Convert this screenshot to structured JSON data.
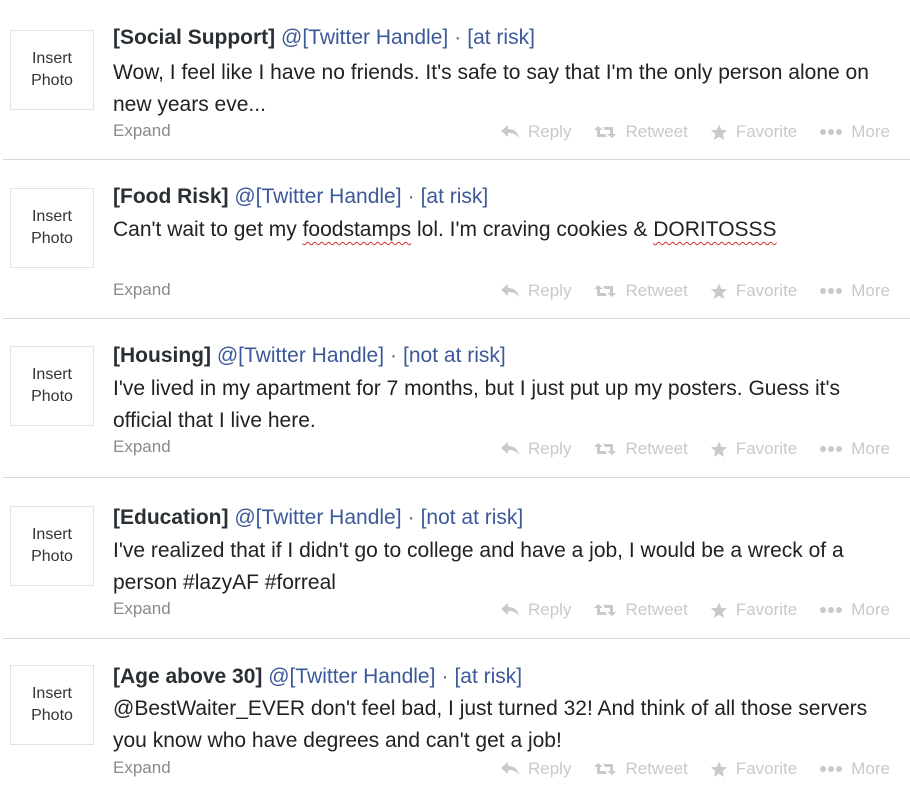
{
  "tweets": [
    {
      "category": "[Social Support]",
      "handle": "@[Twitter Handle]",
      "separator": "·",
      "risk": "[at risk]",
      "text": "Wow, I feel like I have no friends. It's safe to say that I'm the only person alone on new years eve...",
      "photo_line1": "Insert",
      "photo_line2": "Photo",
      "expand": "Expand"
    },
    {
      "category": "[Food Risk]",
      "handle": "@[Twitter Handle]",
      "separator": "·",
      "risk": "[at risk]",
      "text_a": "Can't wait to get my ",
      "text_b": "foodstamps",
      "text_c": " lol. I'm craving cookies & ",
      "text_d": "DORITOSSS",
      "photo_line1": "Insert",
      "photo_line2": "Photo",
      "expand": "Expand"
    },
    {
      "category": "[Housing]",
      "handle": "@[Twitter Handle]",
      "separator": "·",
      "risk": "[not at risk]",
      "text": "I've lived in my apartment for 7 months, but I just put up my posters. Guess it's official that I live here.",
      "photo_line1": "Insert",
      "photo_line2": "Photo",
      "expand": "Expand"
    },
    {
      "category": "[Education]",
      "handle": "@[Twitter Handle]",
      "separator": "·",
      "risk": "[not at risk]",
      "text": "I've realized that if I didn't go to college and have a job, I would be a wreck of a person #lazyAF #forreal",
      "photo_line1": "Insert",
      "photo_line2": "Photo",
      "expand": "Expand"
    },
    {
      "category": "[Age above 30]",
      "handle": "@[Twitter Handle]",
      "separator": "·",
      "risk": "[at risk]",
      "text": "@BestWaiter_EVER don't feel bad, I just turned 32! And think of all those servers you know who have degrees and can't get a job!",
      "photo_line1": "Insert",
      "photo_line2": "Photo",
      "expand": "Expand"
    }
  ],
  "actions": {
    "reply": "Reply",
    "retweet": "Retweet",
    "favorite": "Favorite",
    "more": "More"
  },
  "icons": [
    "reply-icon",
    "retweet-icon",
    "favorite-icon",
    "more-icon"
  ],
  "colors": {
    "link": "#3b5998",
    "muted": "#c9c9c9",
    "expand": "#8a8a8a",
    "spellcheck": "#d0312d"
  }
}
